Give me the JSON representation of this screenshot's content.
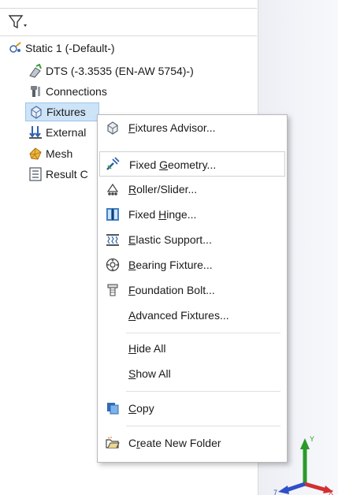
{
  "tree": {
    "study": {
      "label": "Static 1 (-Default-)"
    },
    "material": {
      "label": "DTS (-3.3535 (EN-AW 5754)-)"
    },
    "connections": {
      "label": "Connections"
    },
    "fixtures": {
      "label": "Fixtures"
    },
    "external": {
      "label": "External"
    },
    "mesh": {
      "label": "Mesh"
    },
    "result": {
      "label": "Result C"
    }
  },
  "menu": {
    "items": [
      {
        "pre": "",
        "acc": "F",
        "post": "ixtures Advisor...",
        "icon": "fixtures-advisor-icon"
      },
      {
        "pre": "Fixed ",
        "acc": "G",
        "post": "eometry...",
        "icon": "fixed-geometry-icon"
      },
      {
        "pre": "",
        "acc": "R",
        "post": "oller/Slider...",
        "icon": "roller-slider-icon"
      },
      {
        "pre": "Fixed ",
        "acc": "H",
        "post": "inge...",
        "icon": "fixed-hinge-icon"
      },
      {
        "pre": "",
        "acc": "E",
        "post": "lastic Support...",
        "icon": "elastic-support-icon"
      },
      {
        "pre": "",
        "acc": "B",
        "post": "earing Fixture...",
        "icon": "bearing-fixture-icon"
      },
      {
        "pre": "",
        "acc": "F",
        "post": "oundation Bolt...",
        "icon": "foundation-bolt-icon"
      },
      {
        "pre": "",
        "acc": "A",
        "post": "dvanced Fixtures...",
        "icon": ""
      },
      {
        "pre": "",
        "acc": "H",
        "post": "ide All",
        "icon": ""
      },
      {
        "pre": "",
        "acc": "S",
        "post": "how All",
        "icon": ""
      },
      {
        "pre": "",
        "acc": "C",
        "post": "opy",
        "icon": "copy-icon"
      },
      {
        "pre": "C",
        "acc": "r",
        "post": "eate New Folder",
        "icon": "new-folder-icon"
      }
    ]
  },
  "triad": {
    "y": "Y",
    "x": "X",
    "z": "7"
  }
}
